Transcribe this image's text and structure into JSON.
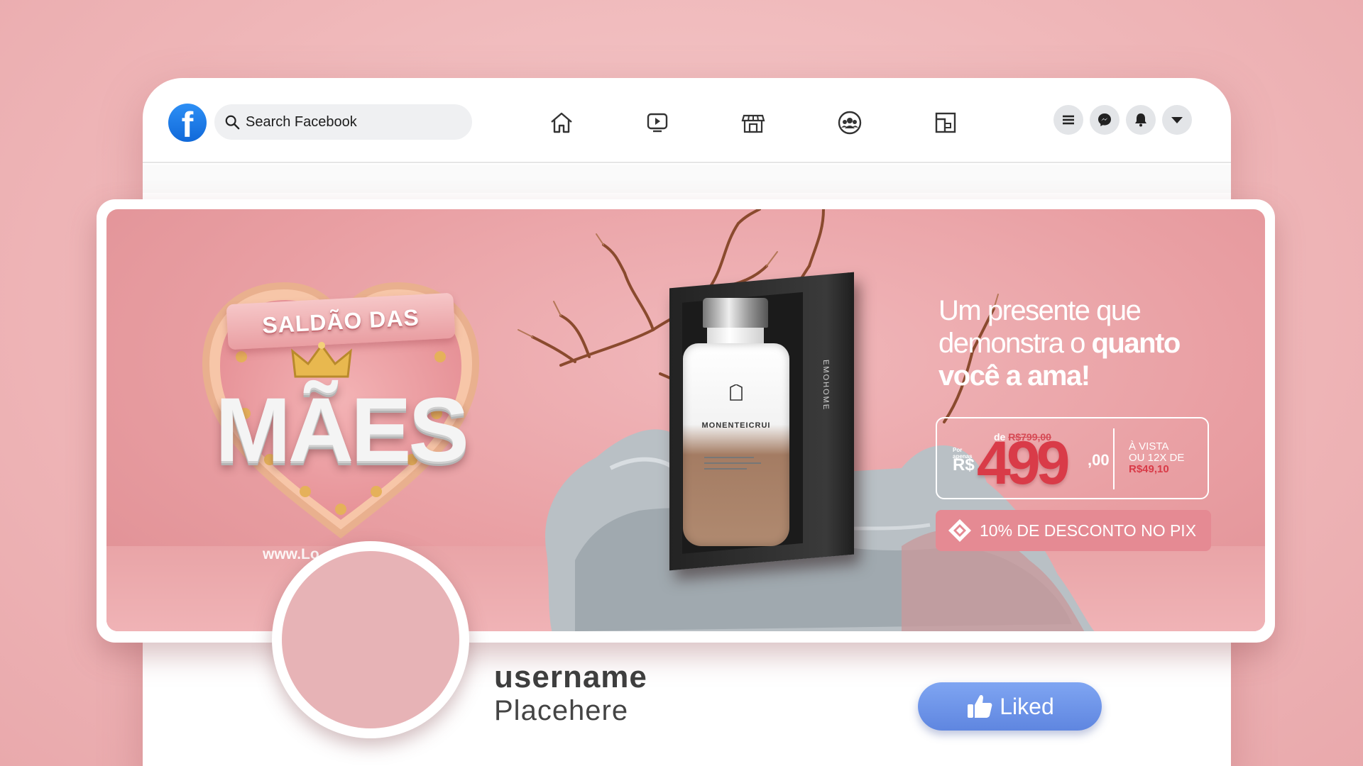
{
  "topbar": {
    "search_placeholder": "Search Facebook",
    "nav_icons": [
      "home-icon",
      "video-icon",
      "marketplace-icon",
      "groups-icon",
      "gaming-icon"
    ],
    "right_icons": [
      "menu-icon",
      "messenger-icon",
      "notifications-icon",
      "account-dropdown-icon"
    ],
    "brand_color": "#1877f2"
  },
  "cover": {
    "badge_ribbon": "SALDÃO DAS",
    "badge_title": "MÃES",
    "website": "www.Lo...........br",
    "product_brand": "MONENTEICRUI",
    "box_side_text": "EMOHOME",
    "headline_regular_1": "Um presente que",
    "headline_regular_2": "demonstra o",
    "headline_bold_2": "quanto",
    "headline_bold_3": "você a ama!",
    "price_de_label": "de",
    "price_old": "R$799,00",
    "price_por_1": "Por",
    "price_por_2": "apenas",
    "currency": "R$",
    "price_main": "499",
    "price_cents": ",00",
    "avista_1": "À VISTA",
    "avista_2": "OU 12X DE",
    "installment": "R$49,10",
    "pix_text": "10% DE DESCONTO NO PIX",
    "accent_color": "#d93b48"
  },
  "profile": {
    "username": "username",
    "subname": "Placehere",
    "liked_label": "Liked"
  }
}
